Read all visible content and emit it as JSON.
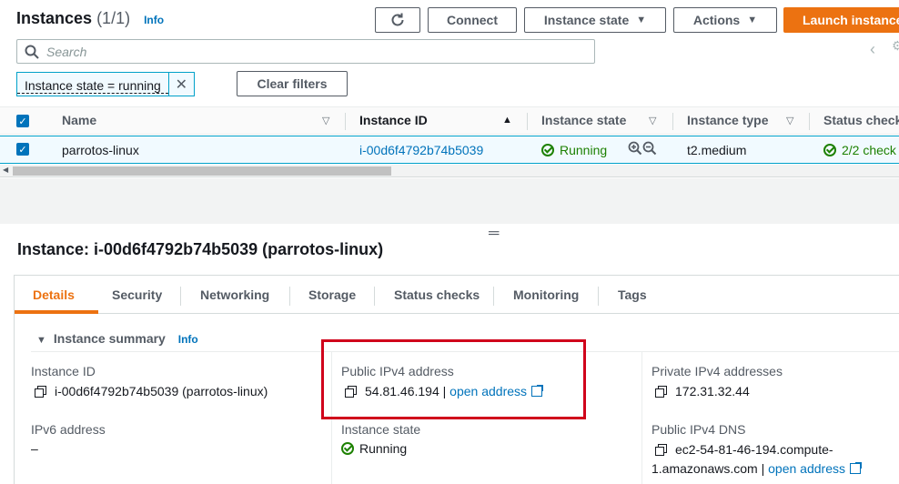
{
  "header": {
    "title": "Instances",
    "count": "(1/1)",
    "info": "Info",
    "refresh_label": "↻",
    "connect_label": "Connect",
    "instance_state_label": "Instance state",
    "actions_label": "Actions",
    "launch_label": "Launch instances"
  },
  "search": {
    "placeholder": "Search"
  },
  "filters": {
    "token": "Instance state = running",
    "clear_label": "Clear filters"
  },
  "table": {
    "columns": [
      "Name",
      "Instance ID",
      "Instance state",
      "Instance type",
      "Status check"
    ],
    "rows": [
      {
        "name": "parrotos-linux",
        "instance_id": "i-00d6f4792b74b5039",
        "state": "Running",
        "type": "t2.medium",
        "status": "2/2 check"
      }
    ]
  },
  "details": {
    "title": "Instance: i-00d6f4792b74b5039 (parrotos-linux)",
    "tabs": [
      "Details",
      "Security",
      "Networking",
      "Storage",
      "Status checks",
      "Monitoring",
      "Tags"
    ],
    "summary_label": "Instance summary",
    "summary_info": "Info",
    "instance_id_label": "Instance ID",
    "instance_id_value": "i-00d6f4792b74b5039 (parrotos-linux)",
    "ipv6_label": "IPv6 address",
    "ipv6_value": "–",
    "public_ipv4_label": "Public IPv4 address",
    "public_ipv4_value": "54.81.46.194",
    "public_ipv4_sep": "|",
    "open_address": "open address",
    "instance_state_label": "Instance state",
    "instance_state_value": "Running",
    "private_ipv4_label": "Private IPv4 addresses",
    "private_ipv4_value": "172.31.32.44",
    "public_dns_label": "Public IPv4 DNS",
    "public_dns_line1": "ec2-54-81-46-194.compute-",
    "public_dns_line2": "1.amazonaws.com",
    "public_dns_sep": "|",
    "open_address_2": "open address"
  },
  "colors": {
    "accent": "#ec7211",
    "link": "#0073bb",
    "success": "#1d8102",
    "highlight": "#d0021b"
  }
}
